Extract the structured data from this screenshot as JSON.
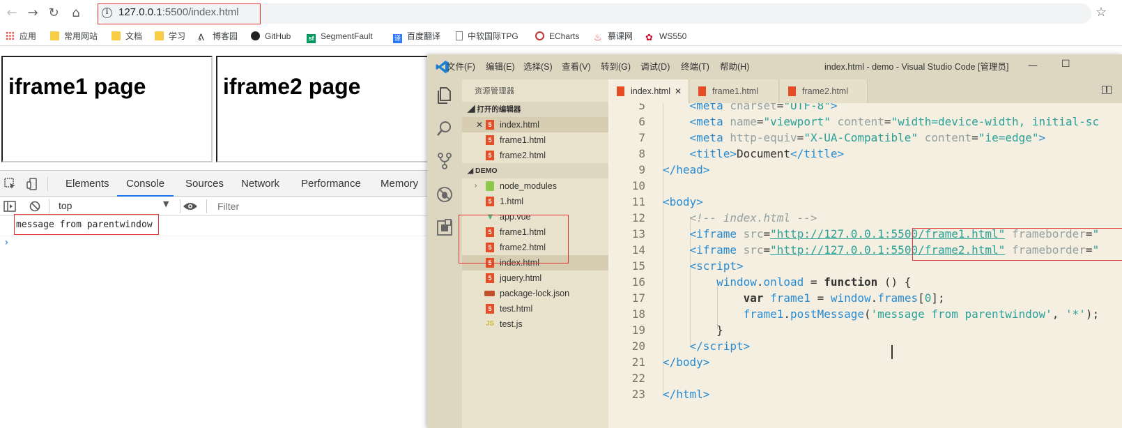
{
  "browser": {
    "url_host": "127.0.0.1",
    "url_rest": ":5500/index.html",
    "bookmarks": [
      {
        "label": "应用",
        "icon": "apps-grid-icon"
      },
      {
        "label": "常用网站",
        "icon": "folder-icon"
      },
      {
        "label": "文档",
        "icon": "folder-icon"
      },
      {
        "label": "学习",
        "icon": "folder-icon"
      },
      {
        "label": "博客园",
        "icon": "cnblogs-icon"
      },
      {
        "label": "GitHub",
        "icon": "github-icon"
      },
      {
        "label": "SegmentFault",
        "icon": "segmentfault-icon"
      },
      {
        "label": "百度翻译",
        "icon": "baidu-translate-icon"
      },
      {
        "label": "中软国际TPG",
        "icon": "page-icon"
      },
      {
        "label": "ECharts",
        "icon": "echarts-icon"
      },
      {
        "label": "慕课网",
        "icon": "imooc-icon"
      },
      {
        "label": "WS550",
        "icon": "huawei-icon"
      }
    ]
  },
  "page": {
    "iframe1_title": "iframe1 page",
    "iframe2_title": "iframe2 page"
  },
  "devtools": {
    "tabs": [
      "Elements",
      "Console",
      "Sources",
      "Network",
      "Performance",
      "Memory"
    ],
    "active_tab": "Console",
    "context": "top",
    "filter_placeholder": "Filter",
    "console_message": "message from parentwindow",
    "prompt": "›"
  },
  "vscode": {
    "menu": [
      "文件(F)",
      "编辑(E)",
      "选择(S)",
      "查看(V)",
      "转到(G)",
      "调试(D)",
      "终端(T)",
      "帮助(H)"
    ],
    "window_title": "index.html - demo - Visual Studio Code [管理员]",
    "sidebar_title": "资源管理器",
    "open_editors_label": "打开的编辑器",
    "open_editors": [
      "index.html",
      "frame1.html",
      "frame2.html"
    ],
    "workspace_label": "DEMO",
    "files": [
      {
        "name": "node_modules",
        "type": "folder"
      },
      {
        "name": "1.html",
        "type": "html"
      },
      {
        "name": "app.vue",
        "type": "vue"
      },
      {
        "name": "frame1.html",
        "type": "html"
      },
      {
        "name": "frame2.html",
        "type": "html"
      },
      {
        "name": "index.html",
        "type": "html"
      },
      {
        "name": "jquery.html",
        "type": "html"
      },
      {
        "name": "package-lock.json",
        "type": "json"
      },
      {
        "name": "test.html",
        "type": "html"
      },
      {
        "name": "test.js",
        "type": "js"
      }
    ],
    "editor_tabs": [
      "index.html",
      "frame1.html",
      "frame2.html"
    ],
    "active_editor_tab": "index.html",
    "line_numbers": [
      "5",
      "6",
      "7",
      "8",
      "9",
      "10",
      "11",
      "12",
      "13",
      "14",
      "15",
      "16",
      "17",
      "18",
      "19",
      "20",
      "21",
      "22",
      "23"
    ]
  },
  "colors": {
    "accent_blue": "#1a73e8",
    "highlight_red": "#e03030",
    "vscode_bg": "#f5efe2",
    "html_icon": "#e44d26"
  }
}
